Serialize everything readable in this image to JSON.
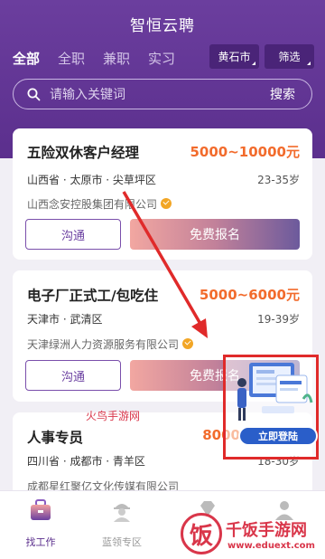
{
  "app": {
    "title": "智恒云聘"
  },
  "tabs": [
    {
      "label": "全部"
    },
    {
      "label": "全职"
    },
    {
      "label": "兼职"
    },
    {
      "label": "实习"
    }
  ],
  "city": {
    "label": "黄石市"
  },
  "filter": {
    "label": "筛选"
  },
  "search": {
    "placeholder": "请输入关键词",
    "button": "搜索",
    "icon": "search-icon"
  },
  "jobs": [
    {
      "title": "五险双休客户经理",
      "salary": "5000~10000元",
      "location": "山西省 · 太原市 · 尖草坪区",
      "age": "23-35岁",
      "company": "山西念安控股集团有限公司",
      "chat": "沟通",
      "apply": "免费报名"
    },
    {
      "title": "电子厂正式工/包吃住",
      "salary": "5000~6000元",
      "location": "天津市 · 武清区",
      "age": "19-39岁",
      "company": "天津绿洲人力资源服务有限公司",
      "chat": "沟通",
      "apply": "免费报名"
    },
    {
      "title": "人事专员",
      "salary": "8000",
      "location": "四川省 · 成都市 · 青羊区",
      "age": "18-30岁",
      "company": "成都星红聚亿文化传媒有限公司"
    }
  ],
  "promo": {
    "login": "立即登陆"
  },
  "nav": [
    {
      "label": "找工作",
      "icon": "briefcase-icon"
    },
    {
      "label": "蓝领专区",
      "icon": "worker-icon"
    },
    {
      "label": "",
      "icon": "diamond-icon"
    },
    {
      "label": "",
      "icon": "person-icon"
    }
  ],
  "watermarks": {
    "site1": "火鸟手游网",
    "site2_glyph": "饭",
    "site2": "千饭手游网",
    "site2_url": "www.eduext.com"
  },
  "colors": {
    "brand": "#5b2f8d",
    "salary": "#f26b2c",
    "annotation": "#e02a2a"
  }
}
